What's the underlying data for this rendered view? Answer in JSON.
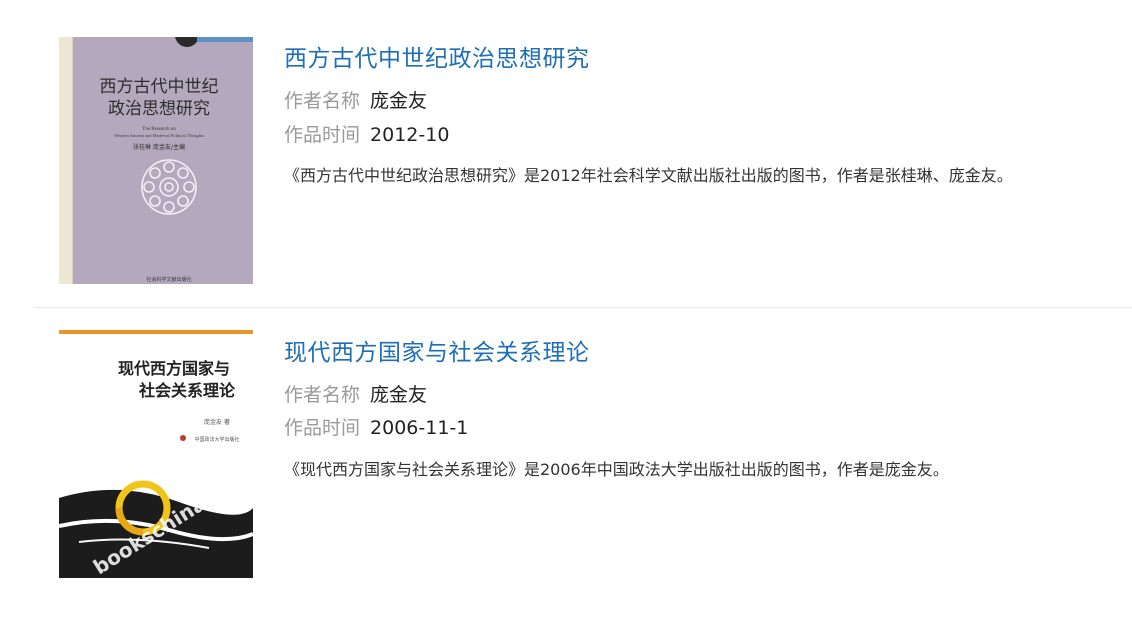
{
  "results": [
    {
      "title": "西方古代中世纪政治思想研究",
      "author_label": "作者名称",
      "author": "庞金友",
      "date_label": "作品时间",
      "date": "2012-10",
      "description": "《西方古代中世纪政治思想研究》是2012年社会科学文献出版社出版的图书，作者是张桂琳、庞金友。",
      "cover": {
        "title_line1": "西方古代中世纪",
        "title_line2": "政治思想研究",
        "subtitle_line1": "The Research on",
        "subtitle_line2": "Western Ancient and Medieval Political Thoughts",
        "editors": "张桂琳  庞金友/主编",
        "publisher": "社会科学文献出版社",
        "background_color": "#b3a8bd"
      }
    },
    {
      "title": "现代西方国家与社会关系理论",
      "author_label": "作者名称",
      "author": "庞金友",
      "date_label": "作品时间",
      "date": "2006-11-1",
      "description": "《现代西方国家与社会关系理论》是2006年中国政法大学出版社出版的图书，作者是庞金友。",
      "cover": {
        "title_line1": "现代西方国家与",
        "title_line2": "社会关系理论",
        "author_mark": "庞金友 著",
        "publisher": "中国政法大学出版社",
        "watermark": "bookschina.com",
        "background_color": "#ffffff"
      }
    }
  ],
  "colors": {
    "link": "#1e6fb5",
    "label": "#9a9a9a",
    "text": "#333333",
    "divider": "#e8e8e8"
  }
}
